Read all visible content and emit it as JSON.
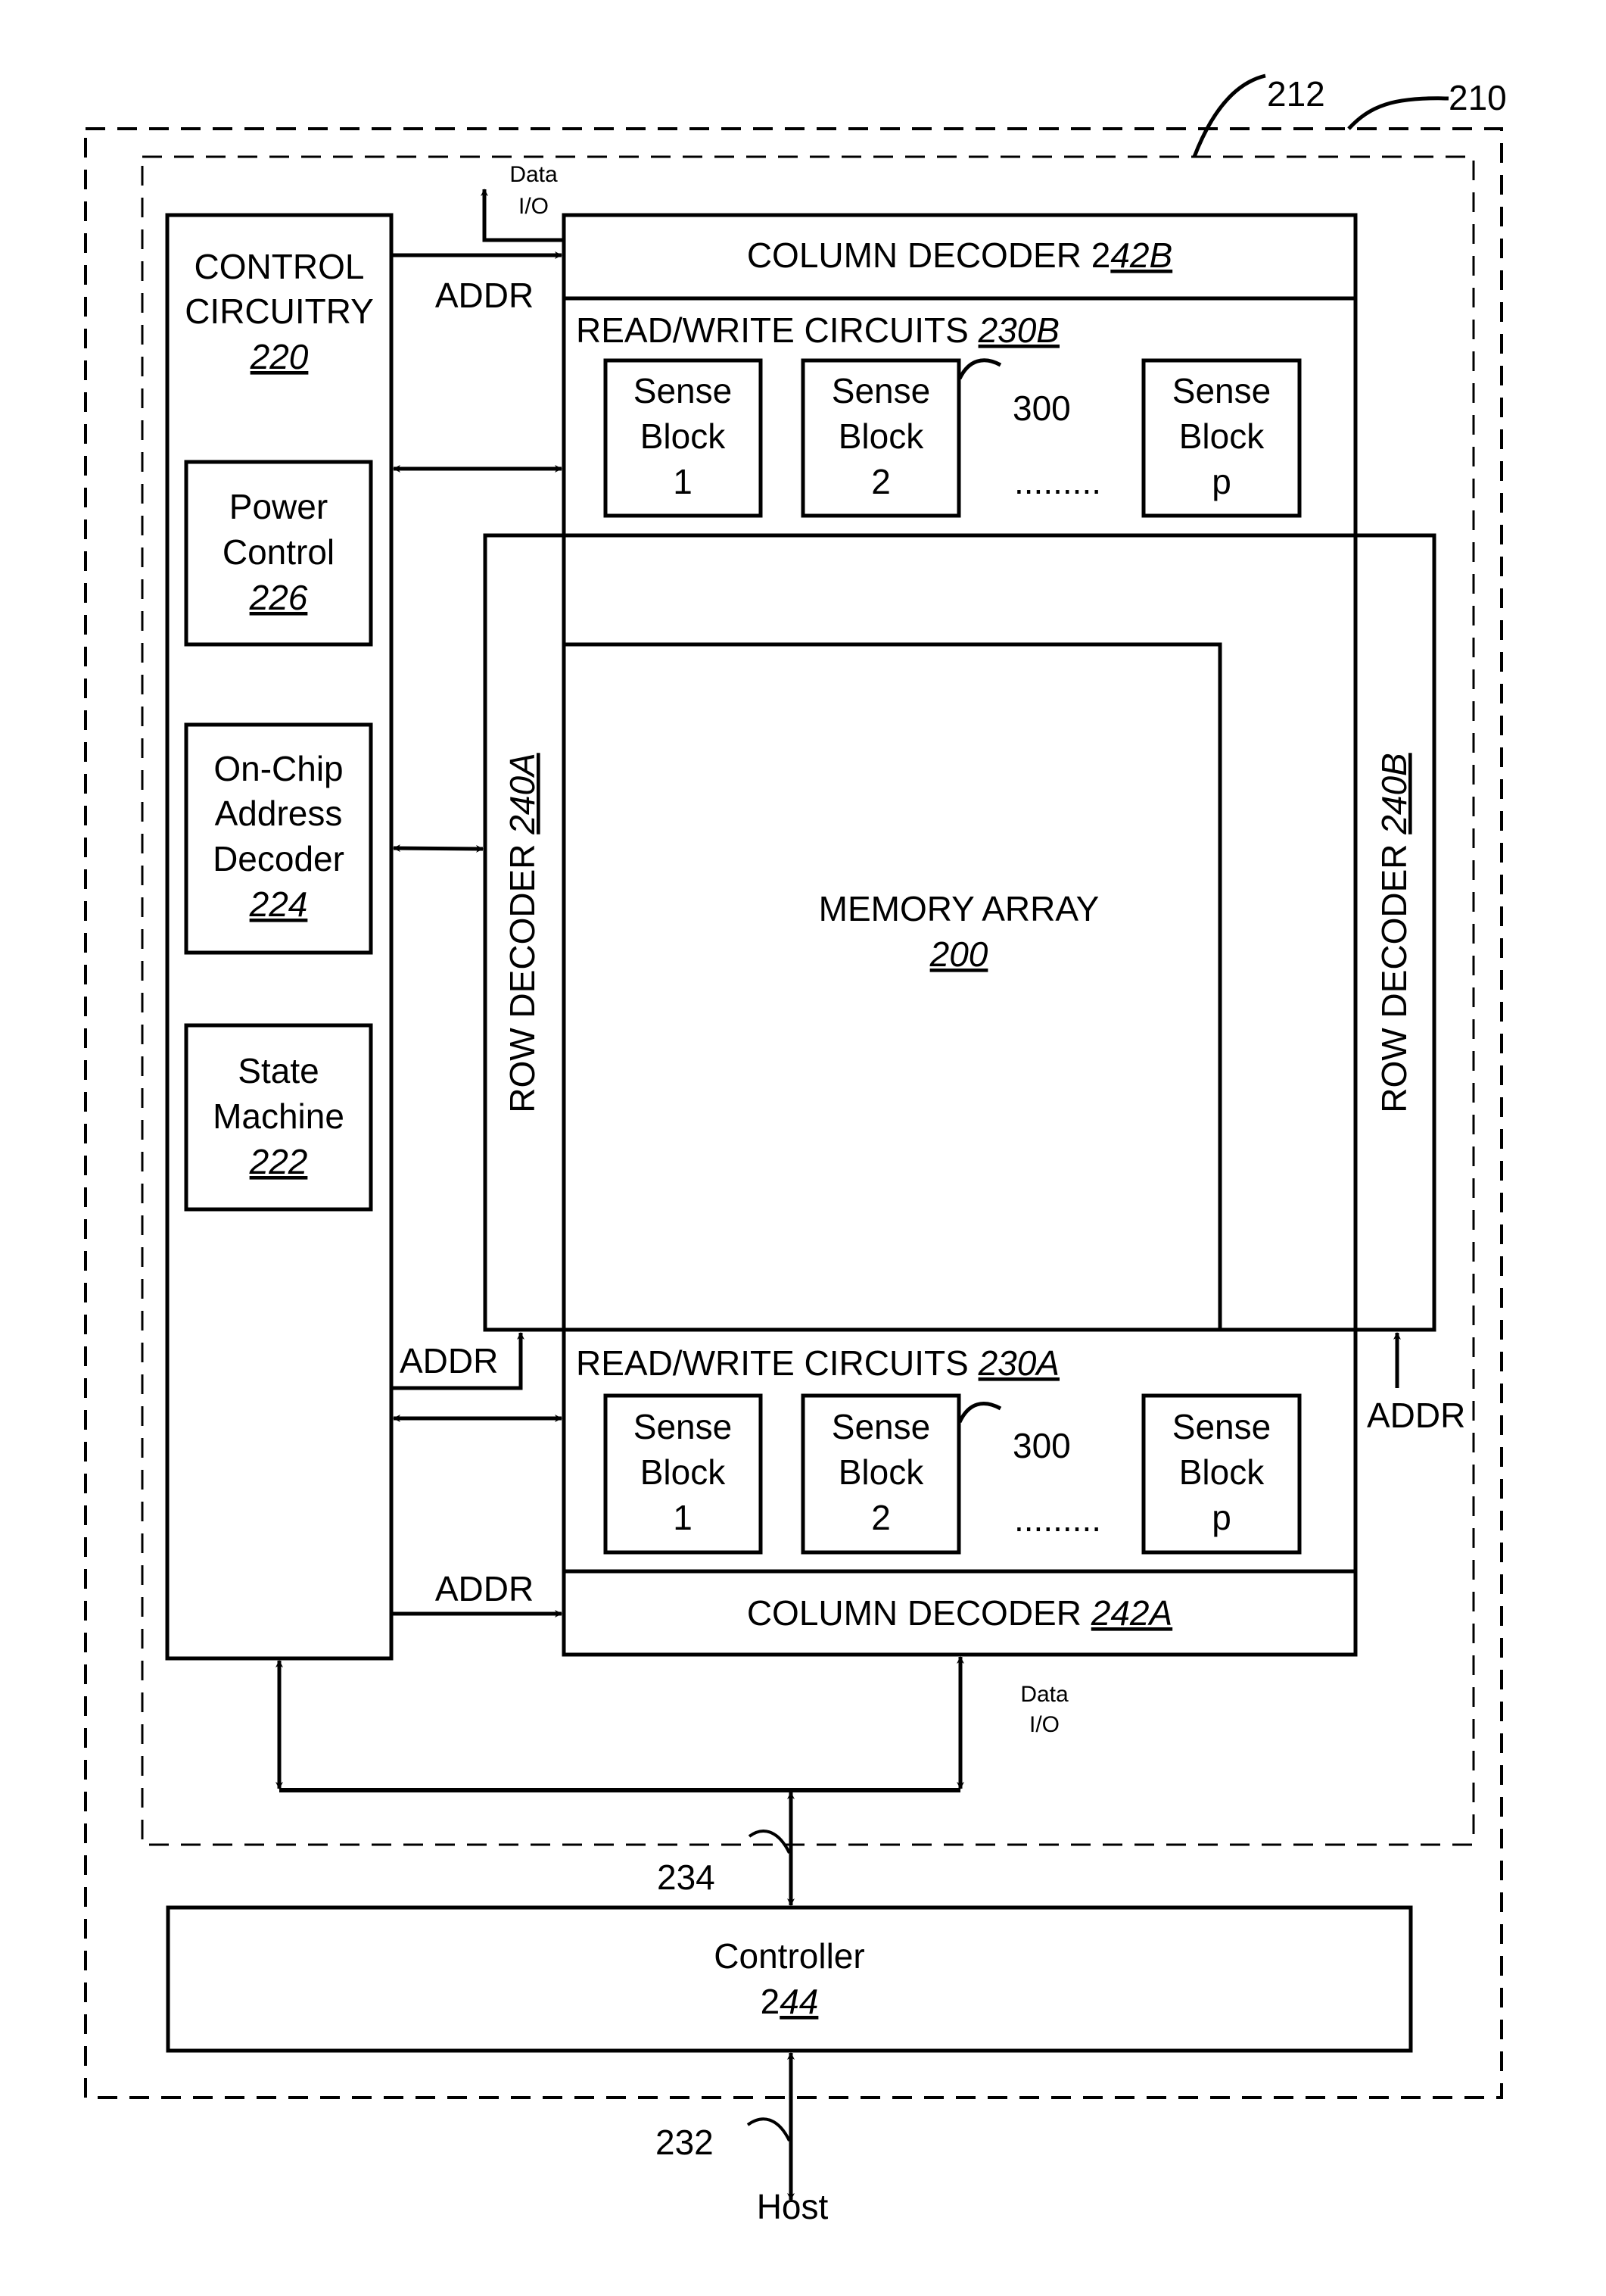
{
  "diagram": {
    "refs": {
      "outer_box": "210",
      "inner_box": "212",
      "bus_234": "234",
      "host_bus": "232",
      "sense_block_ref_top": "300",
      "sense_block_ref_bottom": "300"
    },
    "control_circuitry": {
      "line1": "CONTROL",
      "line2": "CIRCUITRY",
      "ref": "220",
      "power_control": {
        "line1": "Power",
        "line2": "Control",
        "ref": "226"
      },
      "address_decoder": {
        "line1": "On-Chip",
        "line2": "Address",
        "line3": "Decoder",
        "ref": "224"
      },
      "state_machine": {
        "line1": "State",
        "line2": "Machine",
        "ref": "222"
      }
    },
    "column_decoder_b": {
      "label": "COLUMN DECODER 2",
      "ref": "42B"
    },
    "column_decoder_a": {
      "label": "COLUMN DECODER ",
      "ref": "242A"
    },
    "rw_circuits_b": {
      "label": "READ/WRITE CIRCUITS ",
      "ref": "230B"
    },
    "rw_circuits_a": {
      "label": "READ/WRITE CIRCUITS ",
      "ref": "230A"
    },
    "sense_blocks": [
      {
        "line1": "Sense",
        "line2": "Block",
        "line3": "1"
      },
      {
        "line1": "Sense",
        "line2": "Block",
        "line3": "2"
      },
      {
        "line1": "Sense",
        "line2": "Block",
        "line3": "p"
      }
    ],
    "ellipsis": ".........",
    "row_decoder_a": {
      "label": "ROW DECODER ",
      "ref": "240A"
    },
    "row_decoder_b": {
      "label": "ROW DECODER ",
      "ref": "240B"
    },
    "memory_array": {
      "label": "MEMORY ARRAY",
      "ref": "200"
    },
    "signals": {
      "addr": "ADDR",
      "data_io_line1": "Data",
      "data_io_line2": "I/O"
    },
    "controller": {
      "label": "Controller",
      "ref_prefix": "2",
      "ref": "44"
    },
    "host": "Host"
  }
}
